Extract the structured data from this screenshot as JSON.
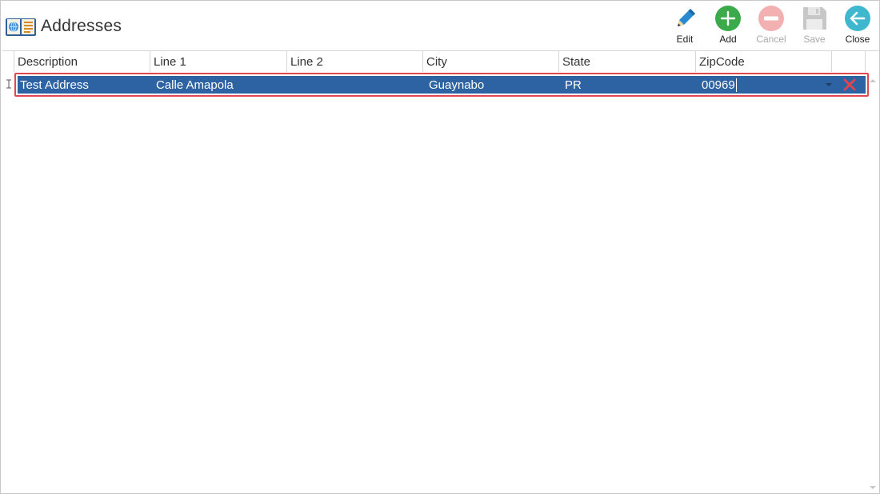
{
  "window": {
    "title": "Addresses"
  },
  "toolbar": {
    "edit_label": "Edit",
    "add_label": "Add",
    "cancel_label": "Cancel",
    "save_label": "Save",
    "close_label": "Close"
  },
  "icons": {
    "app": "address-book-icon",
    "edit": "pencil-icon",
    "add": "plus-circle-icon",
    "cancel": "minus-circle-icon",
    "save": "floppy-disk-icon",
    "close": "back-arrow-icon",
    "delete": "red-x-icon",
    "row_marker": "text-cursor-icon"
  },
  "colors": {
    "selection": "#2d63a3",
    "selection_border": "#e0464e",
    "add": "#3aaa4b",
    "close": "#3fb8cf",
    "cancel_disabled": "#f2b0b0",
    "save_disabled": "#c7c7c7",
    "edit": "#2a8ad0"
  },
  "grid": {
    "columns": [
      "Description",
      "Line 1",
      "Line 2",
      "City",
      "State",
      "ZipCode"
    ],
    "rows": [
      {
        "description": "Test Address",
        "line1": "Calle Amapola",
        "line2": "",
        "city": "Guaynabo",
        "state": "PR",
        "zipcode": "00969"
      }
    ]
  }
}
